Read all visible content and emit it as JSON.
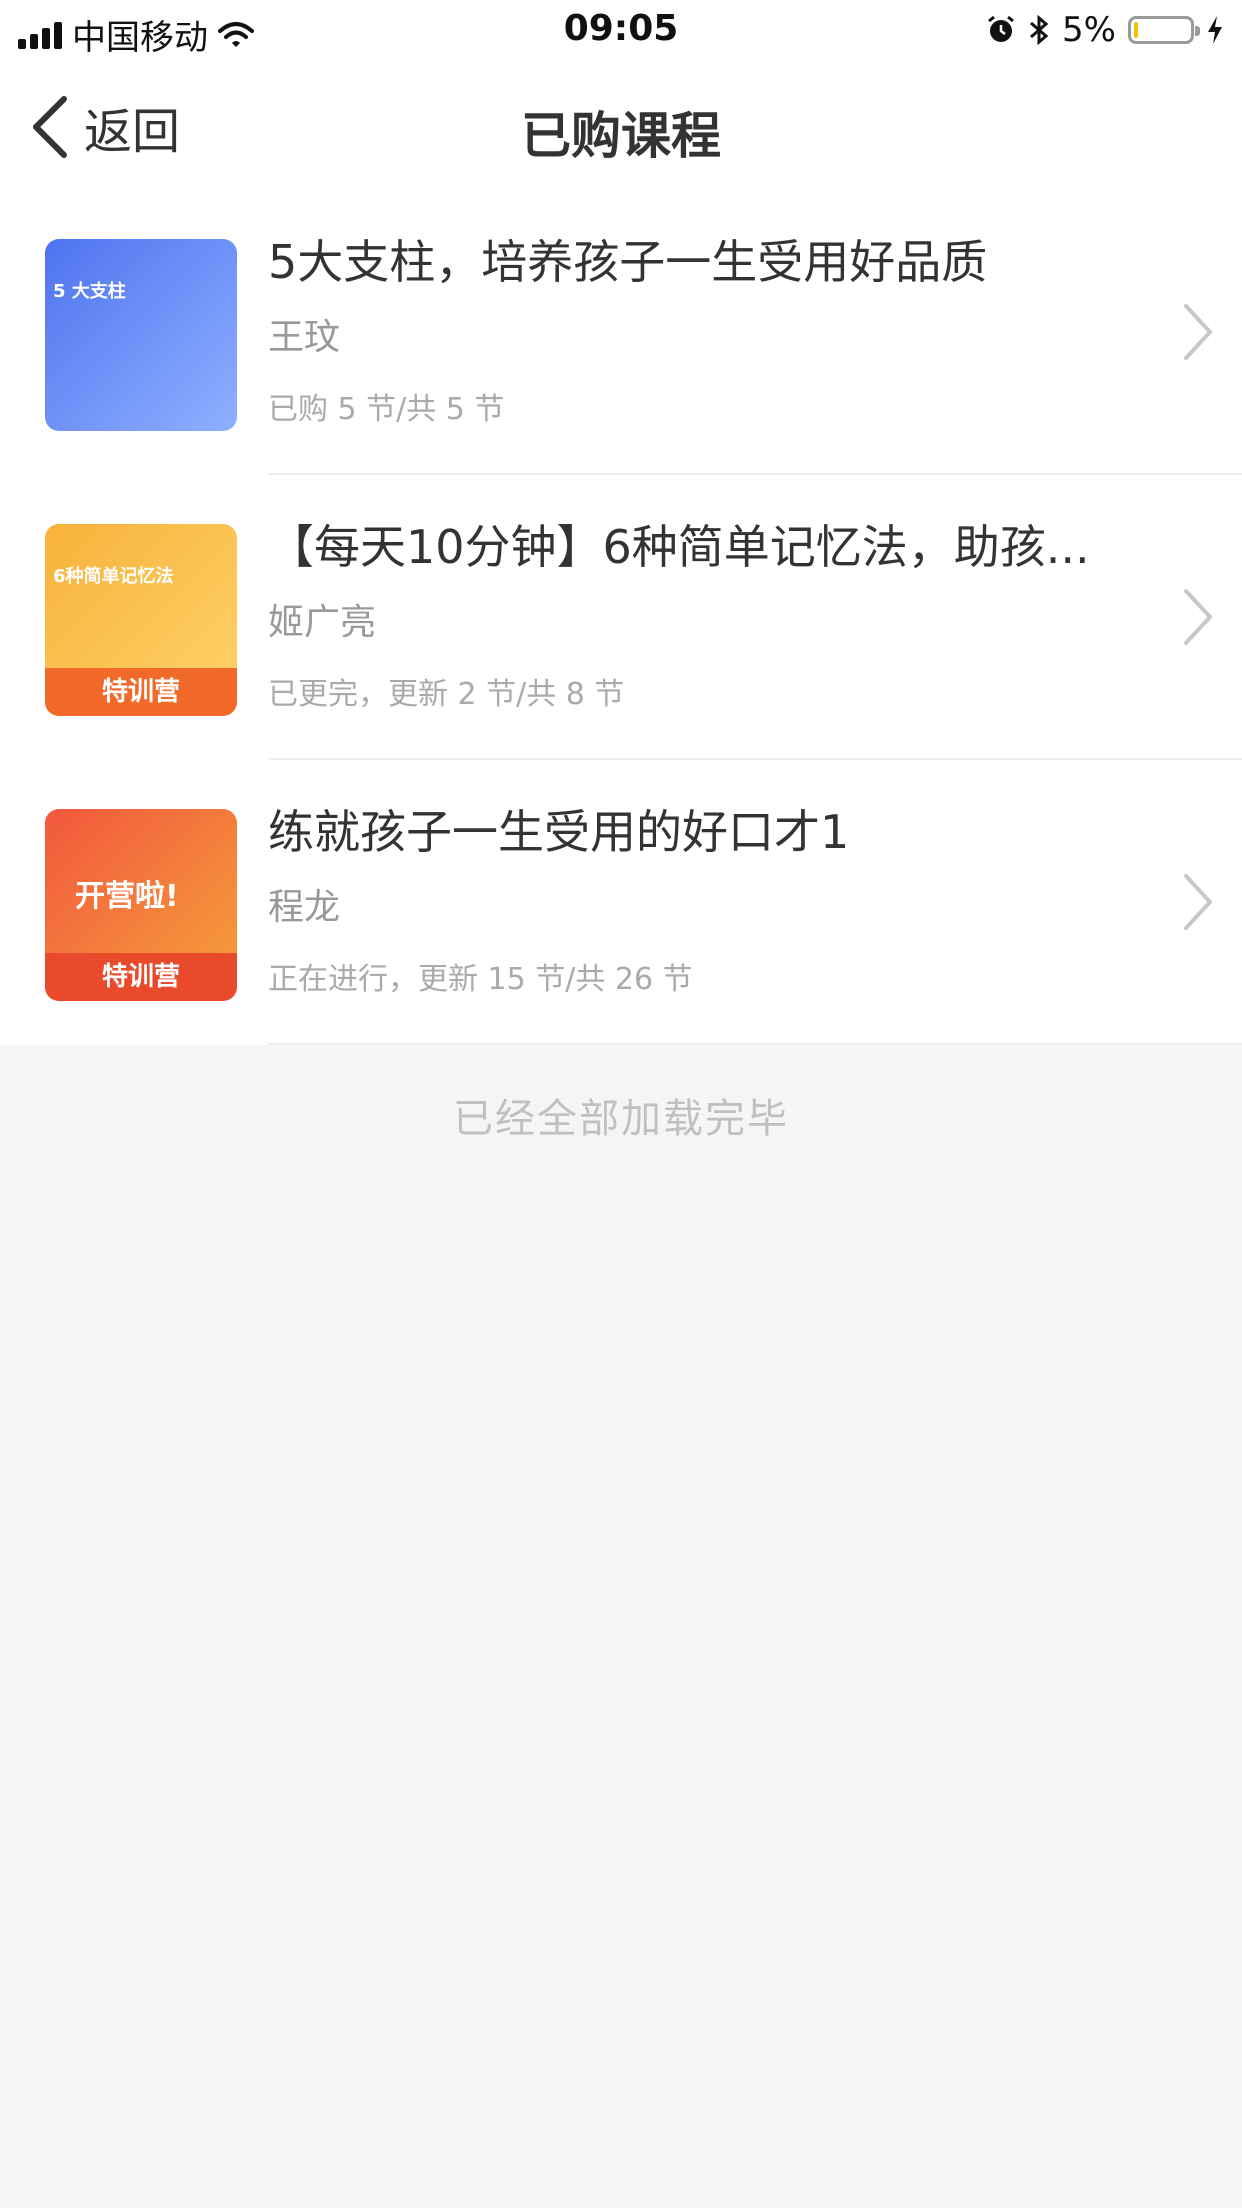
{
  "status_bar": {
    "carrier": "中国移动",
    "time": "09:05",
    "battery": "5%",
    "battery_level": 0.05
  },
  "nav": {
    "back_label": "返回",
    "title": "已购课程"
  },
  "courses": [
    {
      "title": "5大支柱，培养孩子一生受用好品质",
      "author": "王玟",
      "progress": "已购 5 节/共 5 节",
      "thumb_text": "5 大支柱",
      "thumb_badge": "",
      "thumb_colors": [
        "#4f73f0",
        "#8fb0ff"
      ]
    },
    {
      "title": "【每天10分钟】6种简单记忆法，助孩...",
      "author": "姬广亮",
      "progress": "已更完，更新 2 节/共 8 节",
      "thumb_text": "6种简单记忆法",
      "thumb_badge": "特训营",
      "thumb_colors": [
        "#f7b23a",
        "#ffd36b"
      ]
    },
    {
      "title": "练就孩子一生受用的好口才1",
      "author": "程龙",
      "progress": "正在进行，更新 15 节/共 26 节",
      "thumb_text": "开营啦!",
      "thumb_badge": "特训营",
      "thumb_colors": [
        "#f2573d",
        "#f5a23a"
      ]
    }
  ],
  "footer": {
    "text": "已经全部加载完毕"
  }
}
